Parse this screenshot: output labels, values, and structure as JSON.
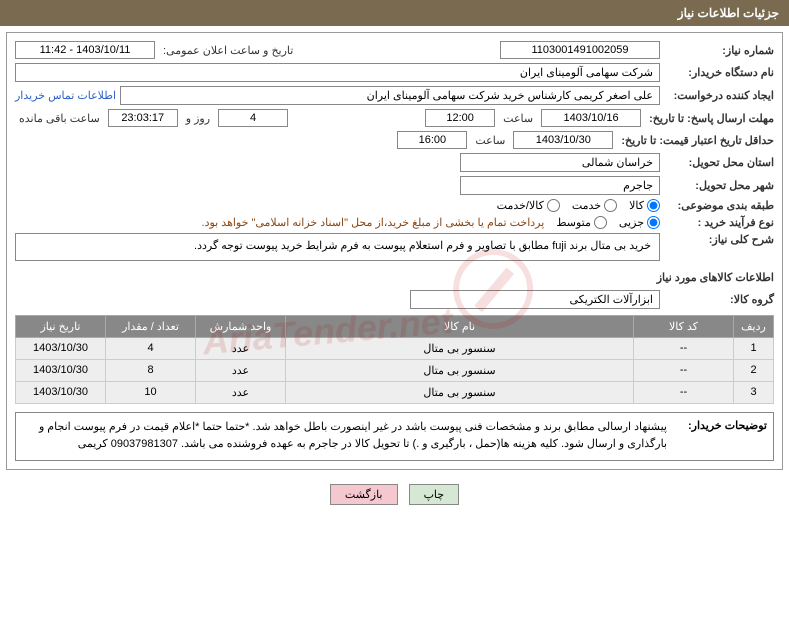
{
  "header": "جزئیات اطلاعات نیاز",
  "fields": {
    "need_no_label": "شماره نیاز:",
    "need_no": "1103001491002059",
    "announce_label": "تاریخ و ساعت اعلان عمومی:",
    "announce_value": "1403/10/11 - 11:42",
    "buyer_org_label": "نام دستگاه خریدار:",
    "buyer_org": "شرکت سهامی آلومینای ایران",
    "requester_label": "ایجاد کننده درخواست:",
    "requester": "علی اصغر کریمی کارشناس خرید شرکت سهامی آلومینای ایران",
    "contact_link": "اطلاعات تماس خریدار",
    "reply_deadline_label": "مهلت ارسال پاسخ: تا تاریخ:",
    "reply_date": "1403/10/16",
    "time_label": "ساعت",
    "reply_time": "12:00",
    "days_left": "4",
    "days_label": "روز و",
    "hours_left": "23:03:17",
    "remain_label": "ساعت باقی مانده",
    "validity_label": "حداقل تاریخ اعتبار قیمت: تا تاریخ:",
    "validity_date": "1403/10/30",
    "validity_time": "16:00",
    "province_label": "استان محل تحویل:",
    "province": "خراسان شمالی",
    "city_label": "شهر محل تحویل:",
    "city": "جاجرم",
    "category_label": "طبقه بندی موضوعی:",
    "cat_goods": "کالا",
    "cat_service": "خدمت",
    "cat_both": "کالا/خدمت",
    "process_label": "نوع فرآیند خرید :",
    "proc_partial": "جزیی",
    "proc_medium": "متوسط",
    "payment_note": "پرداخت تمام یا بخشی از مبلغ خرید،از محل \"اسناد خزانه اسلامی\" خواهد بود.",
    "summary_label": "شرح کلی نیاز:",
    "summary_text": "خرید بی متال برند fuji  مطابق با تصاویر و فرم استعلام پیوست\nبه فرم شرایط خرید پیوست توجه گردد.",
    "goods_info_title": "اطلاعات کالاهای مورد نیاز",
    "group_label": "گروه کالا:",
    "group_value": "ابزارآلات الکتریکی",
    "buyer_desc_label": "توضیحات خریدار:",
    "buyer_desc": "پیشنهاد ارسالی مطابق برند و مشخصات فنی پیوست باشد در غیر اینصورت باطل خواهد شد.\n*حتما حتما *اعلام قیمت در فرم پیوست انجام و بارگذاری و ارسال شود.\nکلیه هزینه ها(حمل ، بارگیری و .) تا تحویل کالا در جاجرم به عهده فروشنده می باشد.\n09037981307 کریمی"
  },
  "table": {
    "headers": [
      "ردیف",
      "کد کالا",
      "نام کالا",
      "واحد شمارش",
      "تعداد / مقدار",
      "تاریخ نیاز"
    ],
    "rows": [
      {
        "no": "1",
        "code": "--",
        "name": "سنسور بی متال",
        "unit": "عدد",
        "qty": "4",
        "date": "1403/10/30"
      },
      {
        "no": "2",
        "code": "--",
        "name": "سنسور بی متال",
        "unit": "عدد",
        "qty": "8",
        "date": "1403/10/30"
      },
      {
        "no": "3",
        "code": "--",
        "name": "سنسور بی متال",
        "unit": "عدد",
        "qty": "10",
        "date": "1403/10/30"
      }
    ]
  },
  "buttons": {
    "print": "چاپ",
    "back": "بازگشت"
  },
  "watermark": "AriaTender.net"
}
